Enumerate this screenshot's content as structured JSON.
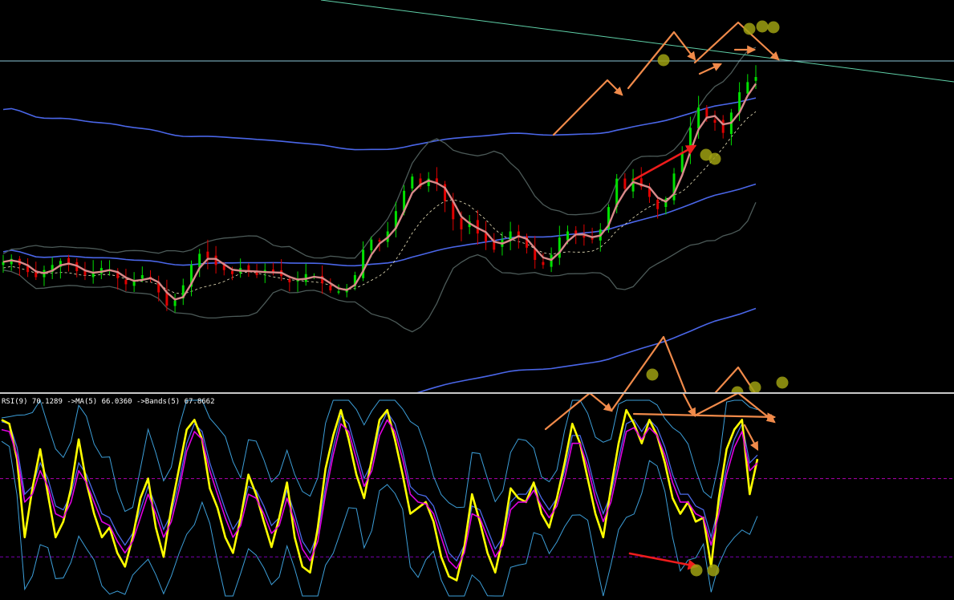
{
  "chart_data": [
    {
      "type": "candlestick",
      "panel": "price",
      "title": "",
      "grid": false,
      "colors": {
        "background": "#000000",
        "bull_candle": "#00e000",
        "bear_candle": "#e00000",
        "fast_ma": "#d88a8a",
        "slow_ma": "#4a66e8",
        "bands": "#4c5a58",
        "signal_dash": "#f0e8c0",
        "trendline": "#5fd0a8",
        "horizontal_line": "#8cc8d8",
        "annotation_arrow": "#f08a4a",
        "divergence_arrow": "#ee1c1c",
        "marker": "#9ea012"
      },
      "close_series": [
        58,
        61,
        55,
        48,
        43,
        50,
        55,
        59,
        55,
        49,
        45,
        48,
        52,
        50,
        42,
        36,
        40,
        45,
        41,
        28,
        15,
        20,
        35,
        55,
        66,
        62,
        55,
        50,
        46,
        52,
        49,
        45,
        50,
        48,
        44,
        38,
        40,
        46,
        44,
        37,
        30,
        29,
        32,
        45,
        70,
        80,
        78,
        88,
        108,
        128,
        142,
        132,
        140,
        135,
        118,
        100,
        90,
        98,
        86,
        78,
        70,
        80,
        88,
        82,
        72,
        60,
        55,
        65,
        82,
        88,
        85,
        82,
        80,
        90,
        112,
        140,
        130,
        140,
        132,
        122,
        110,
        120,
        145,
        165,
        190,
        210,
        200,
        195,
        185,
        205,
        225,
        235,
        240
      ]
    },
    {
      "type": "line",
      "panel": "oscillator",
      "indicator_text": "RSI(9) 70.1289  ->MA(5) 66.0360  ->Bands(5) 67.8662",
      "ylim": [
        0,
        100
      ],
      "grid": false,
      "reference_levels": [
        60,
        20
      ],
      "series": [
        {
          "color": "#ffff00",
          "values": [
            90,
            88,
            70,
            30,
            55,
            75,
            52,
            30,
            38,
            55,
            80,
            58,
            42,
            30,
            35,
            22,
            15,
            30,
            50,
            60,
            35,
            20,
            45,
            65,
            85,
            90,
            80,
            55,
            45,
            30,
            22,
            40,
            62,
            52,
            38,
            25,
            40,
            58,
            30,
            15,
            12,
            35,
            65,
            82,
            95,
            80,
            62,
            50,
            70,
            90,
            95,
            80,
            62,
            42,
            45,
            48,
            38,
            20,
            10,
            8,
            25,
            52,
            38,
            22,
            12,
            30,
            55,
            50,
            48,
            58,
            42,
            35,
            50,
            68,
            88,
            78,
            60,
            42,
            30,
            55,
            78,
            95,
            88,
            78,
            90,
            82,
            68,
            50,
            42,
            48,
            38,
            40,
            15,
            50,
            75,
            85,
            90,
            52,
            70
          ]
        },
        {
          "color": "#e000e0",
          "values": [
            85,
            84,
            72,
            48,
            52,
            64,
            56,
            42,
            40,
            48,
            64,
            58,
            48,
            38,
            36,
            28,
            22,
            28,
            40,
            52,
            42,
            30,
            38,
            54,
            74,
            84,
            80,
            64,
            52,
            40,
            30,
            36,
            52,
            50,
            42,
            32,
            36,
            50,
            38,
            24,
            18,
            28,
            52,
            72,
            88,
            84,
            70,
            56,
            64,
            82,
            90,
            84,
            70,
            52,
            48,
            47,
            42,
            30,
            18,
            14,
            22,
            42,
            40,
            30,
            20,
            26,
            44,
            48,
            48,
            54,
            46,
            40,
            46,
            60,
            78,
            78,
            66,
            50,
            38,
            48,
            66,
            84,
            86,
            80,
            86,
            82,
            72,
            58,
            48,
            48,
            42,
            40,
            26,
            42,
            62,
            76,
            84,
            64,
            68
          ]
        }
      ]
    }
  ]
}
